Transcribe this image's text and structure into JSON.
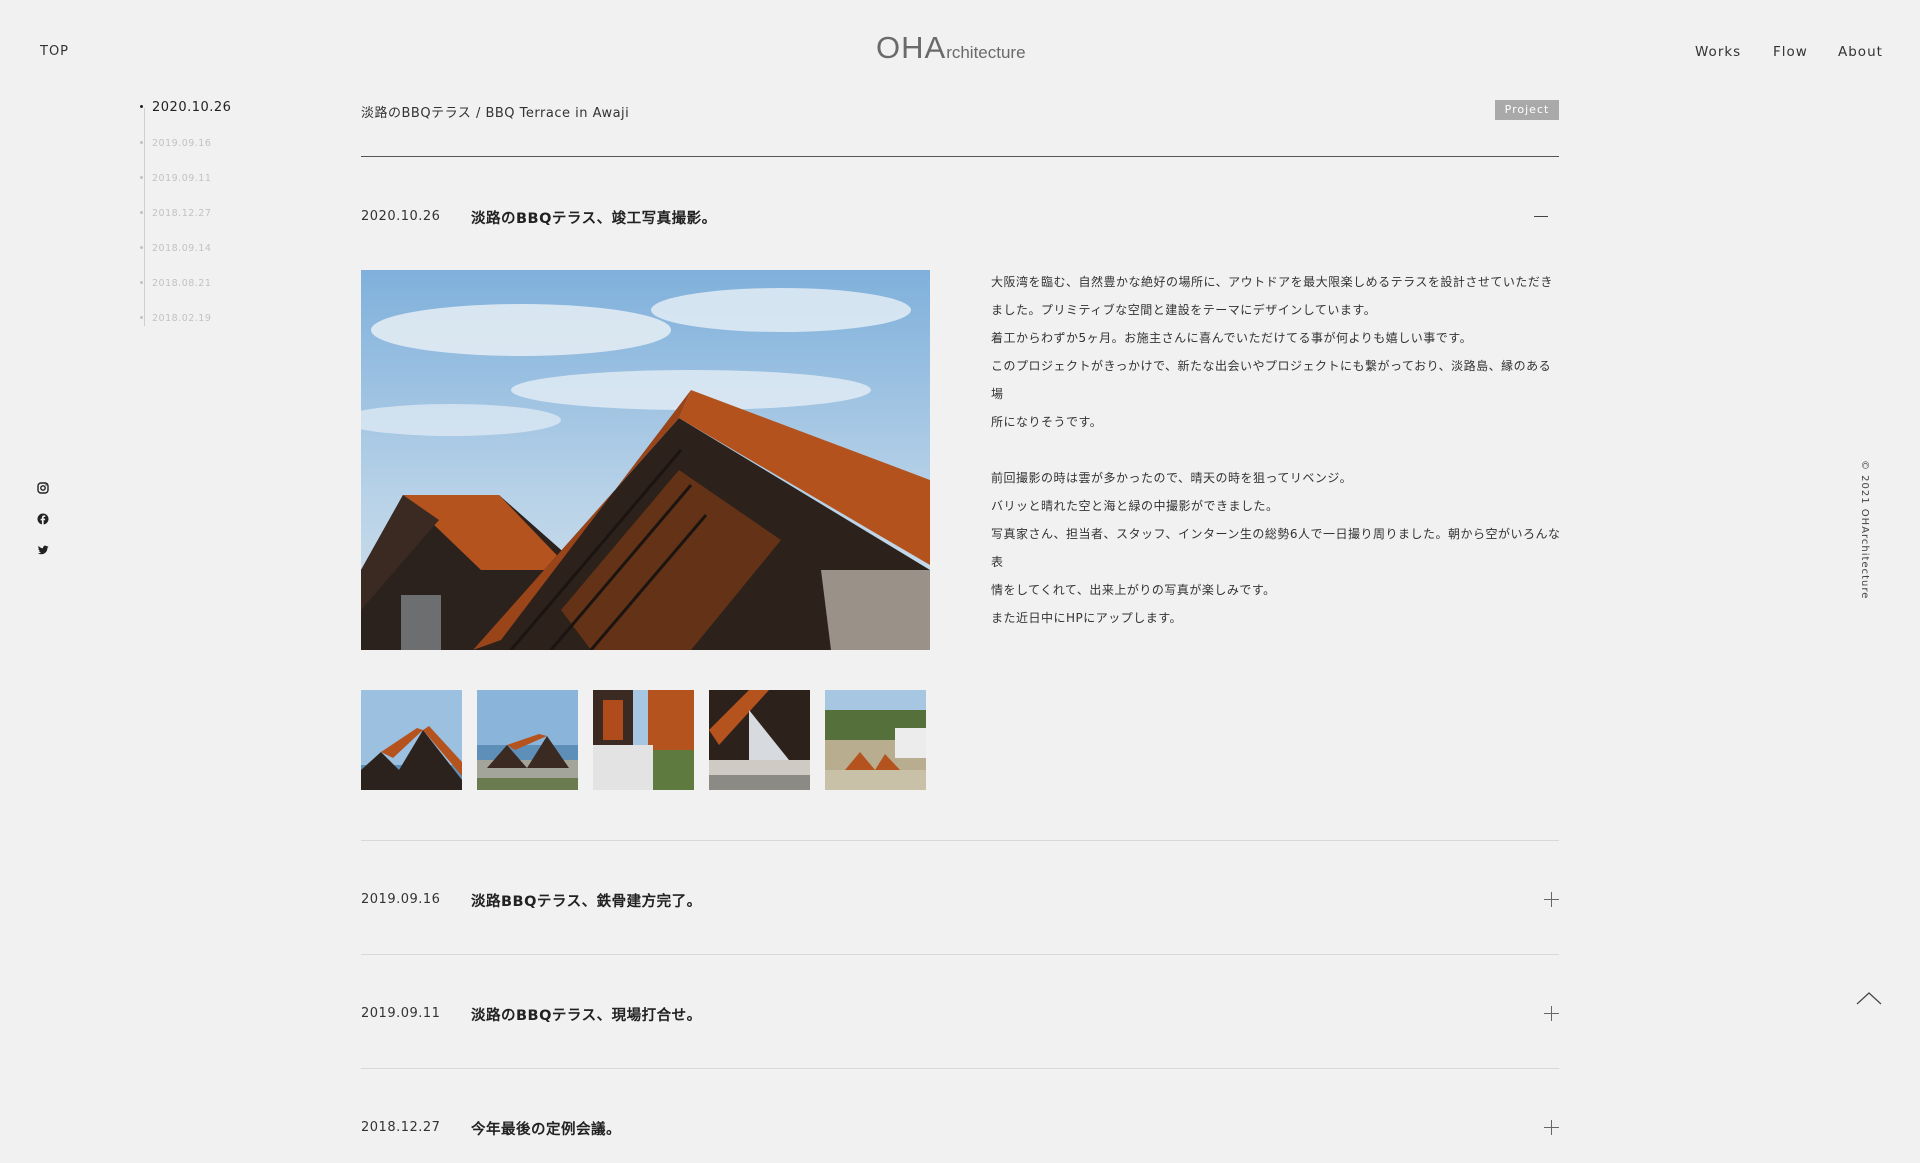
{
  "header": {
    "top_label": "TOP",
    "logo_main": "OHA",
    "logo_sub": "rchitecture",
    "nav": [
      "Works",
      "Flow",
      "About"
    ]
  },
  "timeline": {
    "items": [
      "2020.10.26",
      "2019.09.16",
      "2019.09.11",
      "2018.12.27",
      "2018.09.14",
      "2018.08.21",
      "2018.02.19"
    ],
    "active_index": 0
  },
  "social": [
    "instagram-icon",
    "facebook-icon",
    "twitter-icon"
  ],
  "project": {
    "title": "淡路のBBQテラス / BBQ Terrace in Awaji",
    "badge": "Project"
  },
  "entries": [
    {
      "date": "2020.10.26",
      "title": "淡路のBBQテラス、竣工写真撮影。",
      "expanded": true
    },
    {
      "date": "2019.09.16",
      "title": "淡路BBQテラス、鉄骨建方完了。",
      "expanded": false
    },
    {
      "date": "2019.09.11",
      "title": "淡路のBBQテラス、現場打合せ。",
      "expanded": false
    },
    {
      "date": "2018.12.27",
      "title": "今年最後の定例会議。",
      "expanded": false
    }
  ],
  "body": {
    "para1": [
      "大阪湾を臨む、自然豊かな絶好の場所に、アウトドアを最大限楽しめるテラスを設計させていただき",
      "ました。プリミティブな空間と建設をテーマにデザインしています。",
      "着工からわずか5ヶ月。お施主さんに喜んでいただけてる事が何よりも嬉しい事です。",
      "このプロジェクトがきっかけで、新たな出会いやプロジェクトにも繋がっており、淡路島、縁のある場",
      "所になりそうです。"
    ],
    "para2": [
      "前回撮影の時は雲が多かったので、晴天の時を狙ってリベンジ。",
      "バリッと晴れた空と海と緑の中撮影ができました。",
      "写真家さん、担当者、スタッフ、インターン生の総勢6人で一日撮り周りました。朝から空がいろんな表",
      "情をしてくれて、出来上がりの写真が楽しみです。",
      "また近日中にHPにアップします。"
    ]
  },
  "copyright": "© 2021  OHArchitecture",
  "colors": {
    "background": "#f1f1f1",
    "badge": "#a9a9a9",
    "rust": "#b5531f",
    "sky": "#9cc0e0",
    "sea": "#5d8fb8"
  }
}
